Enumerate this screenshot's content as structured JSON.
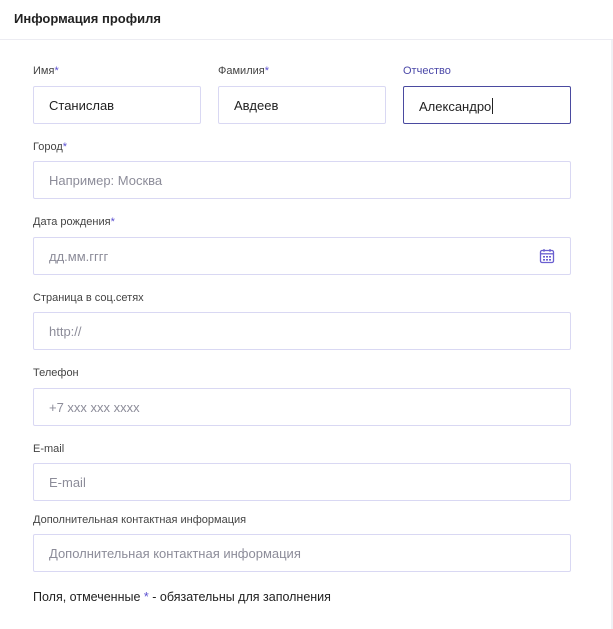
{
  "header": {
    "title": "Информация профиля"
  },
  "form": {
    "first_name": {
      "label": "Имя",
      "required_mark": "*",
      "value": "Станислав"
    },
    "last_name": {
      "label": "Фамилия",
      "required_mark": "*",
      "value": "Авдеев"
    },
    "patronymic": {
      "label": "Отчество",
      "value": "Александро"
    },
    "city": {
      "label": "Город",
      "required_mark": "*",
      "placeholder": "Например: Москва"
    },
    "birth_date": {
      "label": "Дата рождения",
      "required_mark": "*",
      "placeholder": "дд.мм.гггг",
      "icon": "calendar-icon"
    },
    "social": {
      "label": "Страница в соц.сетях",
      "placeholder": "http://"
    },
    "phone": {
      "label": "Телефон",
      "placeholder": "+7 xxx xxx xxxx"
    },
    "email": {
      "label": "E-mail",
      "placeholder": "E-mail"
    },
    "extra_contact": {
      "label": "Дополнительная контактная информация",
      "placeholder": "Дополнительная контактная информация"
    }
  },
  "footer": {
    "note_prefix": "Поля, отмеченные ",
    "note_star": "*",
    "note_suffix": " - обязательны для заполнения"
  },
  "colors": {
    "accent": "#5a4fcf",
    "focus_border": "#4a4aa0",
    "field_border": "#d9d8f3"
  }
}
